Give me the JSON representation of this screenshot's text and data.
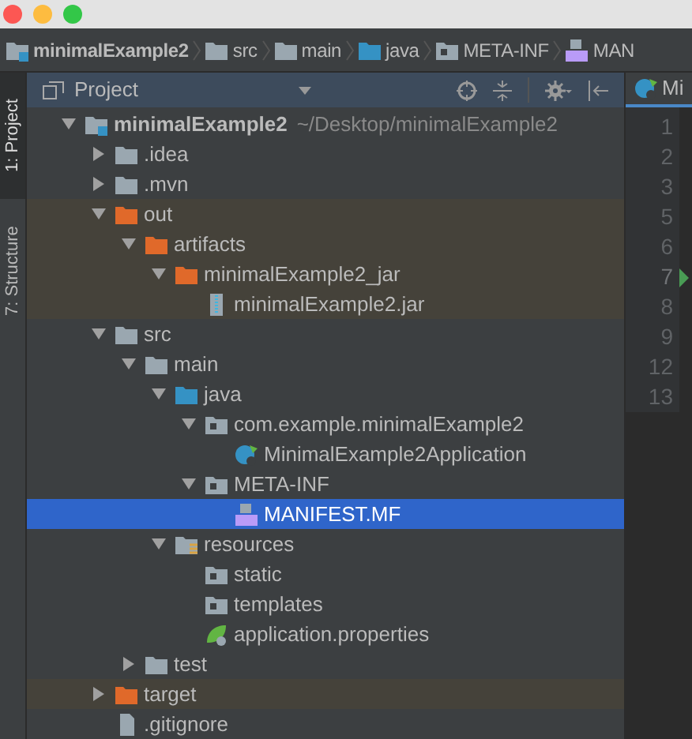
{
  "breadcrumbs": [
    {
      "label": "minimalExample2",
      "kind": "module"
    },
    {
      "label": "src",
      "kind": "folder"
    },
    {
      "label": "main",
      "kind": "folder"
    },
    {
      "label": "java",
      "kind": "source"
    },
    {
      "label": "META-INF",
      "kind": "package"
    },
    {
      "label": "MAN",
      "kind": "manifest"
    }
  ],
  "side_tabs": [
    {
      "label": "1: Project",
      "selected": true
    },
    {
      "label": "7: Structure",
      "selected": false
    }
  ],
  "panel": {
    "title": "Project"
  },
  "tree": [
    {
      "name": "minimalExample2",
      "path": "~/Desktop/minimalExample2",
      "kind": "module",
      "expanded": true,
      "selected": false,
      "children": [
        {
          "name": ".idea",
          "kind": "folder",
          "expanded": false,
          "selected": false
        },
        {
          "name": ".mvn",
          "kind": "folder",
          "expanded": false,
          "selected": false
        },
        {
          "name": "out",
          "kind": "excluded",
          "expanded": true,
          "selected": false,
          "children": [
            {
              "name": "artifacts",
              "kind": "excluded",
              "expanded": true,
              "selected": false,
              "children": [
                {
                  "name": "minimalExample2_jar",
                  "kind": "excluded",
                  "expanded": true,
                  "selected": false,
                  "children": [
                    {
                      "name": "minimalExample2.jar",
                      "kind": "jar",
                      "selected": false
                    }
                  ]
                }
              ]
            }
          ]
        },
        {
          "name": "src",
          "kind": "folder",
          "expanded": true,
          "selected": false,
          "children": [
            {
              "name": "main",
              "kind": "folder",
              "expanded": true,
              "selected": false,
              "children": [
                {
                  "name": "java",
                  "kind": "source",
                  "expanded": true,
                  "selected": false,
                  "children": [
                    {
                      "name": "com.example.minimalExample2",
                      "kind": "package",
                      "expanded": true,
                      "selected": false,
                      "children": [
                        {
                          "name": "MinimalExample2Application",
                          "kind": "spring-class",
                          "selected": false
                        }
                      ]
                    },
                    {
                      "name": "META-INF",
                      "kind": "package",
                      "expanded": true,
                      "selected": false,
                      "children": [
                        {
                          "name": "MANIFEST.MF",
                          "kind": "manifest",
                          "selected": true
                        }
                      ]
                    }
                  ]
                },
                {
                  "name": "resources",
                  "kind": "resources",
                  "expanded": true,
                  "selected": false,
                  "children": [
                    {
                      "name": "static",
                      "kind": "package",
                      "selected": false
                    },
                    {
                      "name": "templates",
                      "kind": "package",
                      "selected": false
                    },
                    {
                      "name": "application.properties",
                      "kind": "spring-file",
                      "selected": false
                    }
                  ]
                }
              ]
            },
            {
              "name": "test",
              "kind": "folder",
              "expanded": false,
              "selected": false
            }
          ]
        },
        {
          "name": "target",
          "kind": "excluded",
          "expanded": false,
          "selected": false
        },
        {
          "name": ".gitignore",
          "kind": "file",
          "selected": false
        }
      ]
    }
  ],
  "editor": {
    "tab": "Mi",
    "lines": [
      {
        "number": "1",
        "run": false
      },
      {
        "number": "2",
        "run": false
      },
      {
        "number": "3",
        "run": false
      },
      {
        "number": "5",
        "run": false
      },
      {
        "number": "6",
        "run": false
      },
      {
        "number": "7",
        "run": true
      },
      {
        "number": "8",
        "run": false
      },
      {
        "number": "9",
        "run": false
      },
      {
        "number": "12",
        "run": false
      },
      {
        "number": "13",
        "run": false
      }
    ]
  }
}
